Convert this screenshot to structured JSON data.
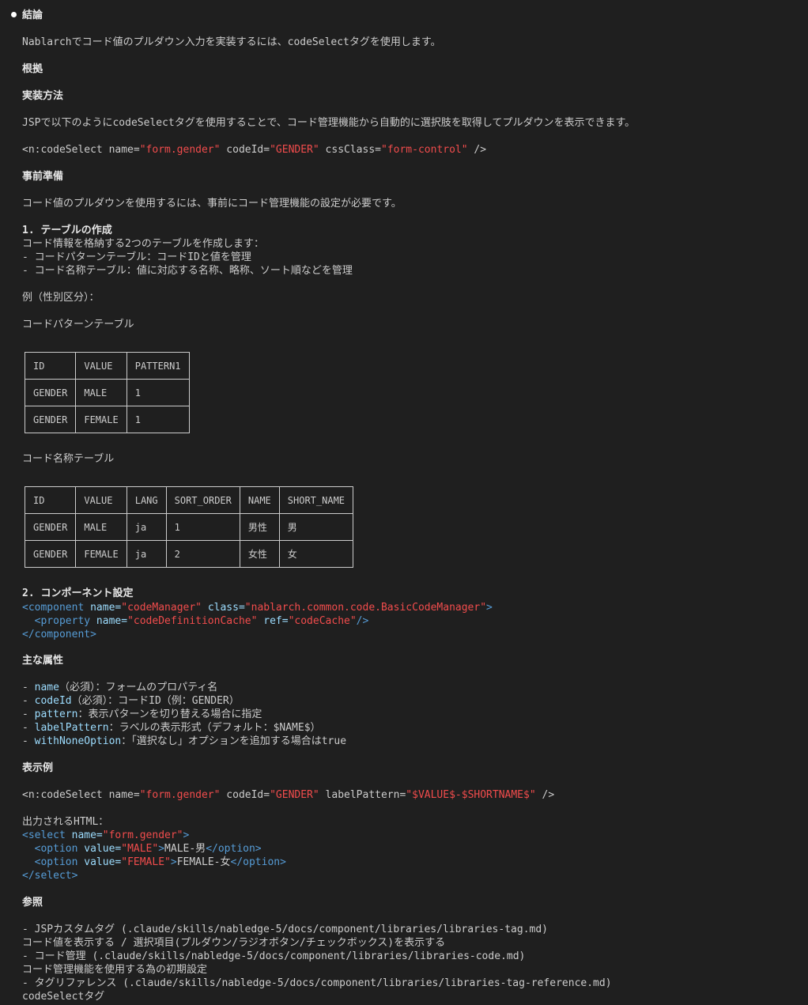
{
  "conclusion_heading": "結論",
  "conclusion_text": "Nablarchでコード値のプルダウン入力を実装するには、codeSelectタグを使用します。",
  "basis_heading": "根拠",
  "method_heading": "実装方法",
  "method_text": "JSPで以下のようにcodeSelectタグを使用することで、コード管理機能から自動的に選択肢を取得してプルダウンを表示できます。",
  "code1": {
    "open": "<n:codeSelect ",
    "a1": "name=",
    "v1": "\"form.gender\"",
    "a2": " codeId=",
    "v2": "\"GENDER\"",
    "a3": " cssClass=",
    "v3": "\"form-control\"",
    "close": " />"
  },
  "prep_heading": "事前準備",
  "prep_text": "コード値のプルダウンを使用するには、事前にコード管理機能の設定が必要です。",
  "step1_heading": "1. テーブルの作成",
  "step1_lines": [
    "コード情報を格納する2つのテーブルを作成します：",
    "- コードパターンテーブル：コードIDと値を管理",
    "- コード名称テーブル：値に対応する名称、略称、ソート順などを管理"
  ],
  "example_label": "例（性別区分）：",
  "pattern_table_title": "コードパターンテーブル",
  "pattern_table": {
    "header": [
      "ID",
      "VALUE",
      "PATTERN1"
    ],
    "rows": [
      [
        "GENDER",
        "MALE",
        "1"
      ],
      [
        "GENDER",
        "FEMALE",
        "1"
      ]
    ]
  },
  "name_table_title": "コード名称テーブル",
  "name_table": {
    "header": [
      "ID",
      "VALUE",
      "LANG",
      "SORT_ORDER",
      "NAME",
      "SHORT_NAME"
    ],
    "rows": [
      [
        "GENDER",
        "MALE",
        "ja",
        "1",
        "男性",
        "男"
      ],
      [
        "GENDER",
        "FEMALE",
        "ja",
        "2",
        "女性",
        "女"
      ]
    ]
  },
  "step2_heading": "2. コンポーネント設定",
  "xml": {
    "l1_tag": "<component",
    "l1_a1": " name=",
    "l1_v1": "\"codeManager\"",
    "l1_a2": " class=",
    "l1_v2": "\"nablarch.common.code.BasicCodeManager\"",
    "l1_end": ">",
    "l2_tag": "  <property",
    "l2_a1": " name=",
    "l2_v1": "\"codeDefinitionCache\"",
    "l2_a2": " ref=",
    "l2_v2": "\"codeCache\"",
    "l2_end": "/>",
    "l3": "</component>"
  },
  "attrs_heading": "主な属性",
  "attrs": [
    {
      "dash": "- ",
      "name": "name",
      "desc": "（必須）：フォームのプロパティ名"
    },
    {
      "dash": "- ",
      "name": "codeId",
      "desc": "（必須）：コードID（例：GENDER）"
    },
    {
      "dash": "- ",
      "name": "pattern",
      "desc": "：表示パターンを切り替える場合に指定"
    },
    {
      "dash": "- ",
      "name": "labelPattern",
      "desc": "：ラベルの表示形式（デフォルト：$NAME$）"
    },
    {
      "dash": "- ",
      "name": "withNoneOption",
      "desc": "：「選択なし」オプションを追加する場合はtrue"
    }
  ],
  "display_heading": "表示例",
  "code2": {
    "open": "<n:codeSelect ",
    "a1": "name=",
    "v1": "\"form.gender\"",
    "a2": " codeId=",
    "v2": "\"GENDER\"",
    "a3": " labelPattern=",
    "v3": "\"$VALUE$-$SHORTNAME$\"",
    "close": " />"
  },
  "output_label": "出力されるHTML：",
  "html_out": {
    "l1_tag": "<select",
    "l1_a": " name=",
    "l1_v": "\"form.gender\"",
    "l1_end": ">",
    "l2_tag": "  <option",
    "l2_a": " value=",
    "l2_v": "\"MALE\"",
    "l2_gt": ">",
    "l2_text": "MALE-男",
    "l2_close": "</option>",
    "l3_tag": "  <option",
    "l3_a": " value=",
    "l3_v": "\"FEMALE\"",
    "l3_gt": ">",
    "l3_text": "FEMALE-女",
    "l3_close": "</option>",
    "l4": "</select>"
  },
  "ref_heading": "参照",
  "refs": [
    "- JSPカスタムタグ (.claude/skills/nabledge-5/docs/component/libraries/libraries-tag.md)",
    "コード値を表示する / 選択項目(プルダウン/ラジオボタン/チェックボックス)を表示する",
    "- コード管理 (.claude/skills/nabledge-5/docs/component/libraries/libraries-code.md)",
    "コード管理機能を使用する為の初期設定",
    "- タグリファレンス (.claude/skills/nabledge-5/docs/component/libraries/libraries-tag-reference.md)",
    "codeSelectタグ"
  ]
}
